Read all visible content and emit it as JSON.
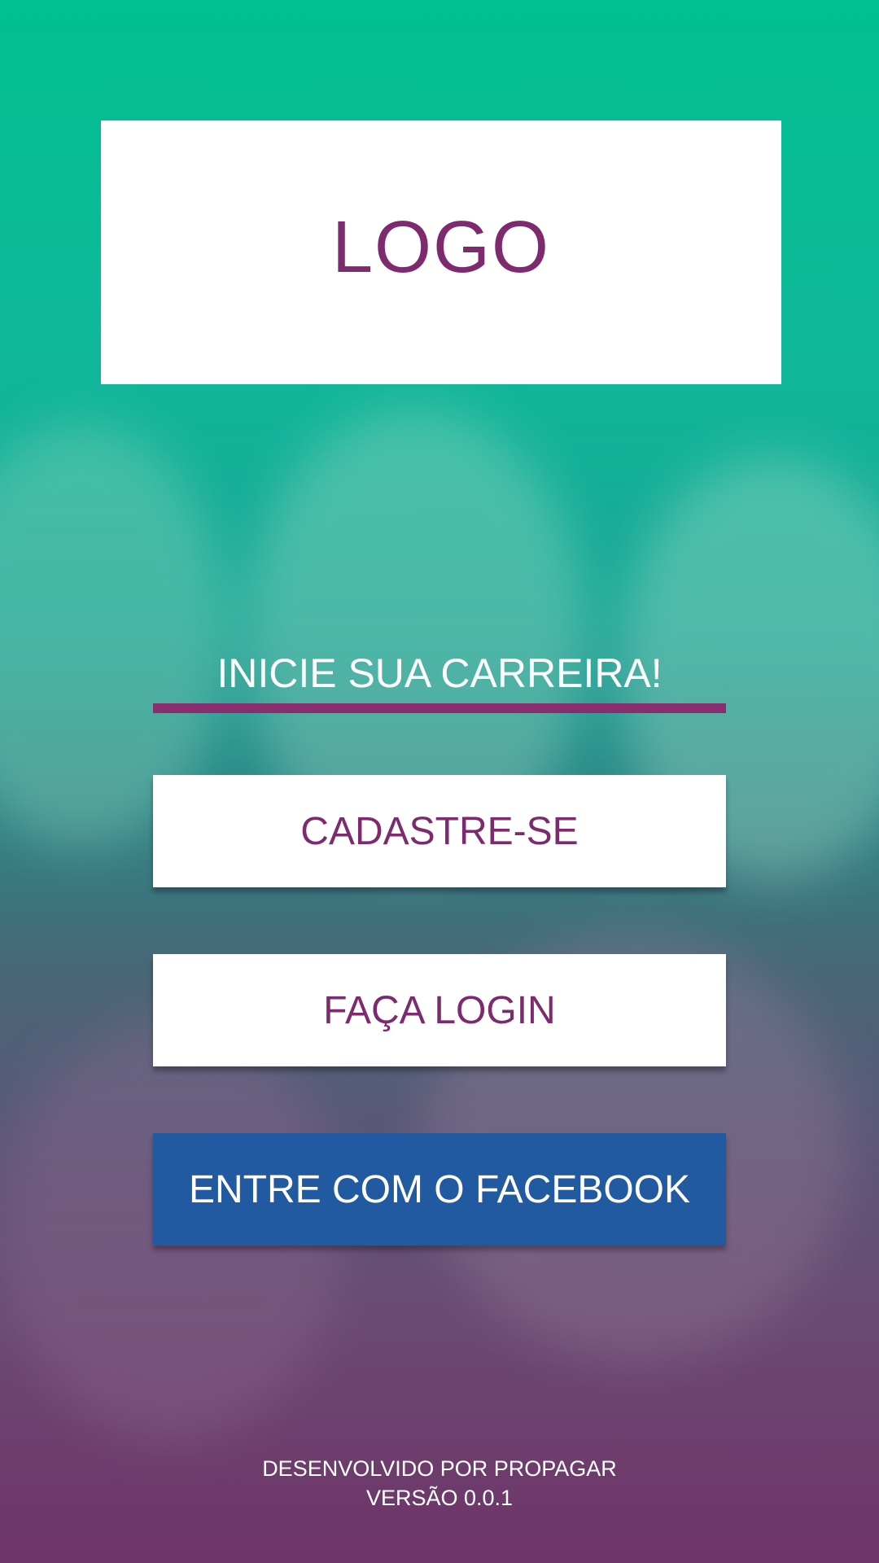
{
  "logo": {
    "text": "LOGO"
  },
  "tagline": {
    "text": "INICIE SUA CARREIRA!"
  },
  "buttons": {
    "signup_label": "CADASTRE-SE",
    "login_label": "FAÇA LOGIN",
    "facebook_label": "ENTRE COM O FACEBOOK"
  },
  "footer": {
    "developer": "DESENVOLVIDO POR PROPAGAR",
    "version": "VERSÃO 0.0.1"
  },
  "colors": {
    "gradient_top": "#00bf90",
    "gradient_bottom": "#6f3468",
    "brand_purple": "#7e2a6e",
    "underline": "#8a2d6f",
    "facebook_blue": "#225aa1",
    "white": "#ffffff"
  }
}
